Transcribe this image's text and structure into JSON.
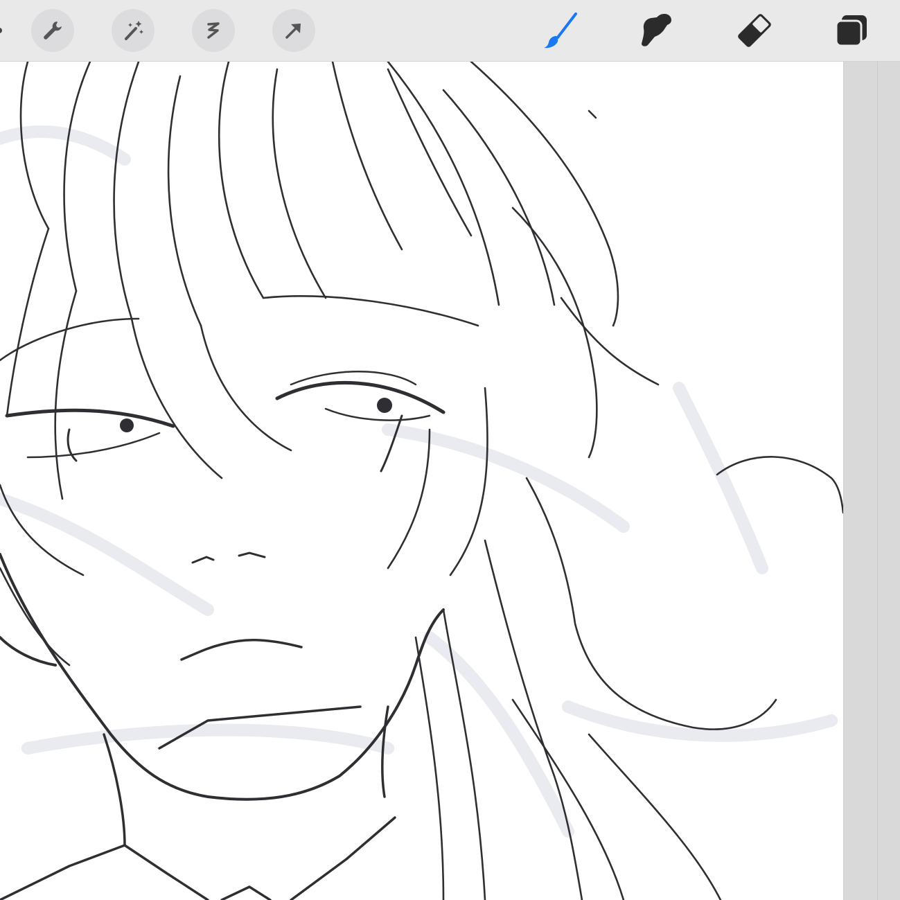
{
  "app": {
    "toolbar": {
      "left_tools": [
        {
          "icon": "actions-wrench-icon"
        },
        {
          "icon": "adjustments-magic-wand-icon"
        },
        {
          "icon": "selection-s-icon"
        },
        {
          "icon": "transform-arrow-icon"
        }
      ],
      "right_tools": [
        {
          "icon": "brush-icon",
          "active": true
        },
        {
          "icon": "smudge-icon"
        },
        {
          "icon": "eraser-icon"
        },
        {
          "icon": "layers-icon"
        }
      ]
    },
    "colors": {
      "toolbar_bg": "#e9e9ea",
      "icon_gray": "#555555",
      "icon_dark": "#2b2b2b",
      "active_accent": "#1a78f2",
      "canvas_bg": "#ffffff",
      "ink": "#2f2f33",
      "sketch_gray": "#e8e9ef"
    }
  }
}
